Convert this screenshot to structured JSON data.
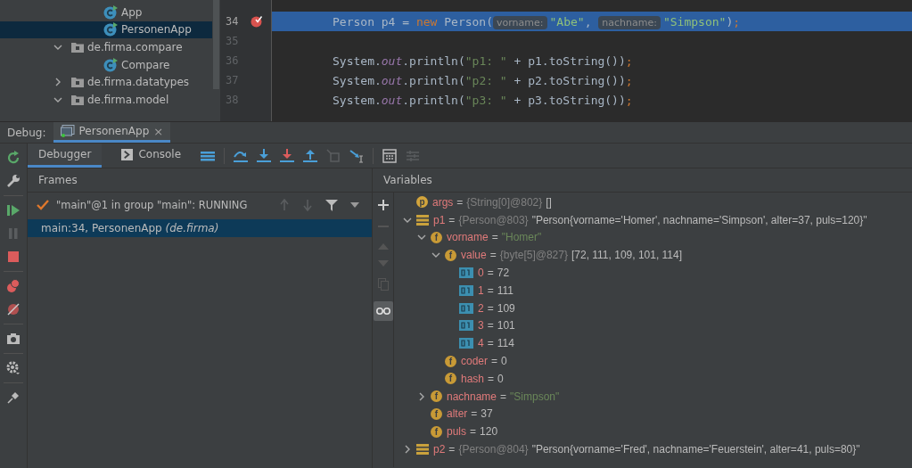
{
  "project_tree": [
    {
      "label": "App",
      "kind": "class",
      "selected": false
    },
    {
      "label": "PersonenApp",
      "kind": "class",
      "selected": true
    },
    {
      "label": "de.firma.compare",
      "kind": "package",
      "expanded": true,
      "selected": false,
      "children": [
        {
          "label": "Compare",
          "kind": "class",
          "selected": false
        }
      ]
    },
    {
      "label": "de.firma.datatypes",
      "kind": "package",
      "expanded": false,
      "selected": false
    },
    {
      "label": "de.firma.model",
      "kind": "package",
      "expanded": true,
      "selected": false
    }
  ],
  "editor": {
    "lines": [
      {
        "number": "34",
        "breakpoint": true,
        "highlighted": true,
        "tokens": [
          {
            "kind": "plain",
            "text": "Person p4 = "
          },
          {
            "kind": "keyword",
            "text": "new"
          },
          {
            "kind": "plain",
            "text": " Person("
          },
          {
            "kind": "hint",
            "text": "vorname:"
          },
          {
            "kind": "string",
            "text": "\"Abe\""
          },
          {
            "kind": "plain",
            "text": ", "
          },
          {
            "kind": "hint",
            "text": "nachname:"
          },
          {
            "kind": "string",
            "text": "\"Simpson\""
          },
          {
            "kind": "plain",
            "text": ")"
          },
          {
            "kind": "punct",
            "text": ";"
          }
        ]
      },
      {
        "number": "35",
        "breakpoint": false,
        "highlighted": false
      },
      {
        "number": "36",
        "breakpoint": false,
        "highlighted": false,
        "tokens": [
          {
            "kind": "plain",
            "text": "System."
          },
          {
            "kind": "static",
            "text": "out"
          },
          {
            "kind": "plain",
            "text": ".println("
          },
          {
            "kind": "string",
            "text": "\"p1: \""
          },
          {
            "kind": "plain",
            "text": " + p1."
          },
          {
            "kind": "method",
            "text": "toString"
          },
          {
            "kind": "plain",
            "text": "())"
          },
          {
            "kind": "punct",
            "text": ";"
          }
        ]
      },
      {
        "number": "37",
        "breakpoint": false,
        "highlighted": false,
        "tokens": [
          {
            "kind": "plain",
            "text": "System."
          },
          {
            "kind": "static",
            "text": "out"
          },
          {
            "kind": "plain",
            "text": ".println("
          },
          {
            "kind": "string",
            "text": "\"p2: \""
          },
          {
            "kind": "plain",
            "text": " + p2."
          },
          {
            "kind": "method",
            "text": "toString"
          },
          {
            "kind": "plain",
            "text": "())"
          },
          {
            "kind": "punct",
            "text": ";"
          }
        ]
      },
      {
        "number": "38",
        "breakpoint": false,
        "highlighted": false,
        "tokens": [
          {
            "kind": "plain",
            "text": "System."
          },
          {
            "kind": "static",
            "text": "out"
          },
          {
            "kind": "plain",
            "text": ".println("
          },
          {
            "kind": "string",
            "text": "\"p3: \""
          },
          {
            "kind": "plain",
            "text": " + p3."
          },
          {
            "kind": "method",
            "text": "toString"
          },
          {
            "kind": "plain",
            "text": "())"
          },
          {
            "kind": "punct",
            "text": ";"
          }
        ]
      }
    ]
  },
  "debug_bar": {
    "label": "Debug:",
    "tab": "PersonenApp",
    "close": "×"
  },
  "debug_tabs": [
    {
      "label": "Debugger",
      "selected": true
    },
    {
      "label": "Console",
      "selected": false
    }
  ],
  "frames": {
    "title": "Frames",
    "thread": "\"main\"@1 in group \"main\": RUNNING",
    "items": [
      {
        "text": "main:34, PersonenApp *(de.firma)*",
        "selected": true
      }
    ]
  },
  "variables": {
    "title": "Variables",
    "separator": "=",
    "items": [
      {
        "kind": "param",
        "badge": "p",
        "name": "args",
        "type": "{String[0]@802}",
        "value": "[]"
      },
      {
        "kind": "object",
        "name": "p1",
        "expanded": true,
        "type": "{Person@803}",
        "value": "\"Person{vorname='Homer', nachname='Simpson', alter=37, puls=120}\"",
        "children": [
          {
            "kind": "field",
            "badge": "f",
            "name": "vorname",
            "expanded": true,
            "value": "\"Homer\"",
            "is_string": true,
            "children": [
              {
                "kind": "field",
                "badge": "f",
                "name": "value",
                "expanded": true,
                "type": "{byte[5]@827}",
                "value": "[72, 111, 109, 101, 114]",
                "children": [
                  {
                    "kind": "primitive",
                    "name": "0",
                    "value": "72"
                  },
                  {
                    "kind": "primitive",
                    "name": "1",
                    "value": "111"
                  },
                  {
                    "kind": "primitive",
                    "name": "2",
                    "value": "109"
                  },
                  {
                    "kind": "primitive",
                    "name": "3",
                    "value": "101"
                  },
                  {
                    "kind": "primitive",
                    "name": "4",
                    "value": "114"
                  }
                ]
              },
              {
                "kind": "field",
                "badge": "f",
                "name": "coder",
                "value": "0"
              },
              {
                "kind": "field",
                "badge": "f",
                "name": "hash",
                "value": "0"
              }
            ]
          },
          {
            "kind": "field",
            "badge": "f",
            "name": "nachname",
            "expanded": false,
            "value": "\"Simpson\"",
            "is_string": true
          },
          {
            "kind": "field",
            "badge": "f",
            "name": "alter",
            "value": "37"
          },
          {
            "kind": "field",
            "badge": "f",
            "name": "puls",
            "value": "120"
          }
        ]
      },
      {
        "kind": "object",
        "name": "p2",
        "expanded": false,
        "type": "{Person@804}",
        "value": "\"Person{vorname='Fred', nachname='Feuerstein', alter=41, puls=80}\""
      }
    ]
  }
}
